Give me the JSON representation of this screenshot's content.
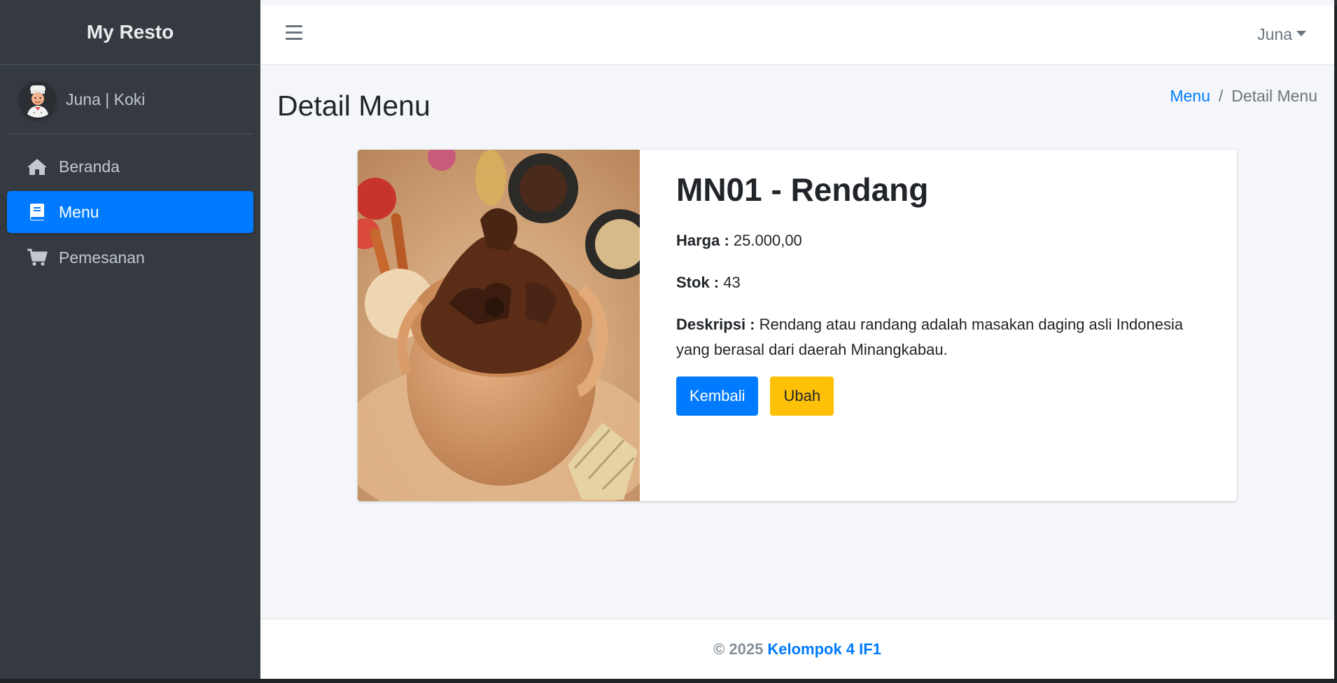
{
  "sidebar": {
    "brand": "My Resto",
    "user": "Juna | Koki",
    "items": [
      {
        "label": "Beranda",
        "icon": "home-icon"
      },
      {
        "label": "Menu",
        "icon": "book-icon",
        "active": true
      },
      {
        "label": "Pemesanan",
        "icon": "cart-icon"
      }
    ]
  },
  "topbar": {
    "user_menu": "Juna"
  },
  "page": {
    "title": "Detail Menu",
    "breadcrumb": {
      "link": "Menu",
      "separator": "/",
      "current": "Detail Menu"
    }
  },
  "detail": {
    "title": "MN01 - Rendang",
    "price_label": "Harga :",
    "price_value": "25.000,00",
    "stock_label": "Stok :",
    "stock_value": "43",
    "desc_label": "Deskripsi :",
    "desc_value": "Rendang atau randang adalah masakan daging asli Indonesia yang berasal dari daerah Minangkabau.",
    "back_button": "Kembali",
    "edit_button": "Ubah"
  },
  "footer": {
    "copyright": "© 2025",
    "link": "Kelompok 4 IF1"
  },
  "colors": {
    "sidebar_bg": "#343a40",
    "primary": "#007bff",
    "warning": "#ffc107",
    "content_bg": "#f4f6f9"
  }
}
